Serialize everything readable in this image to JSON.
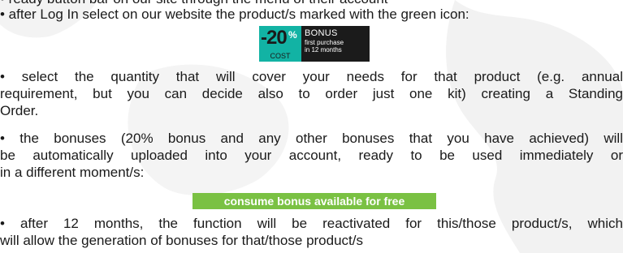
{
  "lines": {
    "top_partial": "• ready button bar on our site through the menu of their account",
    "login_step": "• after Log In select on our website the product/s marked with the green icon:",
    "quantity_step": [
      "• select the quantity that will cover your needs for that product (e.g. annual",
      "requirement, but you can decide also to order just one kit) creating a Standing",
      "Order."
    ],
    "bonuses_step": [
      "• the bonuses (20% bonus and any other bonuses that you have achieved) will",
      "be automatically uploaded into your account, ready to be used immediately or",
      "in a different moment/s:"
    ],
    "reactivate_step": [
      "• after 12 months, the function will be reactivated for this/those product/s, which",
      "will allow the generation of bonuses for that/those product/s"
    ]
  },
  "badge": {
    "percent": "-20",
    "percent_sign": "%",
    "cost": "COST",
    "bonus": "BONUS",
    "sub1": "first purchase",
    "sub2": "in 12 months"
  },
  "consume_button": "consume bonus available for free",
  "colors": {
    "badge_green": "#12b3a4",
    "badge_dark": "#1b1b1b",
    "button_green": "#7ac143"
  }
}
